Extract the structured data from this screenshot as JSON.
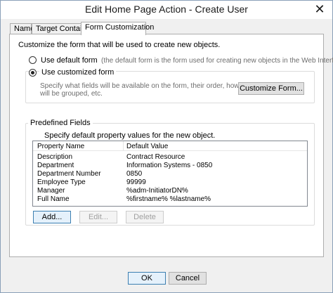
{
  "window": {
    "title": "Edit Home Page Action - Create User",
    "close_glyph": "✕"
  },
  "tabs": [
    {
      "label": "Name",
      "active": false
    },
    {
      "label": "Target Container",
      "active": false
    },
    {
      "label": "Form Customization",
      "active": true
    }
  ],
  "form": {
    "intro": "Customize the form that will be used to create new objects.",
    "use_default": {
      "label": "Use default form",
      "hint": "(the default form is the form used for creating new objects in the Web Interface)",
      "checked": false
    },
    "use_custom": {
      "label": "Use customized form",
      "hint_line1": "Specify what fields will be available on the form, their order, how these fields",
      "hint_line2": "will be grouped, etc.",
      "checked": true
    },
    "customize_button": "Customize Form..."
  },
  "predefined": {
    "title": "Predefined Fields",
    "description": "Specify default property values for the new object.",
    "columns": [
      "Property Name",
      "Default Value"
    ],
    "rows": [
      [
        "Description",
        "Contract Resource"
      ],
      [
        "Department",
        "Information Systems - 0850"
      ],
      [
        "Department Number",
        "0850"
      ],
      [
        "Employee Type",
        "99999"
      ],
      [
        "Manager",
        "%adm-InitiatorDN%"
      ],
      [
        "Full Name",
        "%firstname% %lastname%"
      ]
    ],
    "add_button": "Add...",
    "edit_button": "Edit...",
    "delete_button": "Delete"
  },
  "footer": {
    "ok_button": "OK",
    "cancel_button": "Cancel"
  }
}
